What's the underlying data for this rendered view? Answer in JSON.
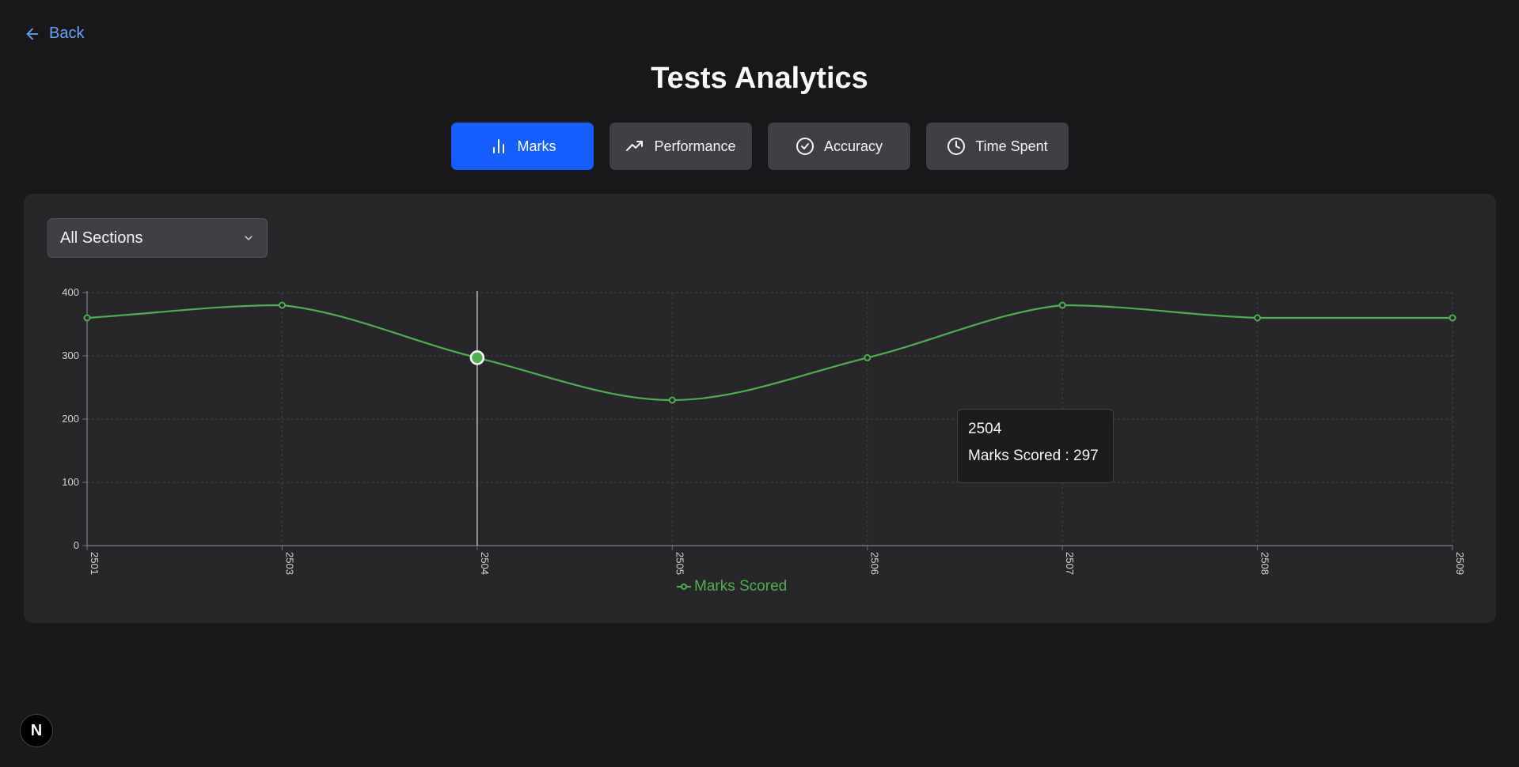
{
  "nav": {
    "back_label": "Back"
  },
  "page": {
    "title": "Tests Analytics"
  },
  "tabs": [
    {
      "label": "Marks",
      "icon": "bar-chart-icon",
      "active": true
    },
    {
      "label": "Performance",
      "icon": "trending-up-icon",
      "active": false
    },
    {
      "label": "Accuracy",
      "icon": "check-circle-icon",
      "active": false
    },
    {
      "label": "Time Spent",
      "icon": "clock-icon",
      "active": false
    }
  ],
  "filter": {
    "selected": "All Sections"
  },
  "tooltip": {
    "label": "2504",
    "series": "Marks Scored",
    "separator": " : ",
    "value": "297"
  },
  "colors": {
    "accent": "#155dfc",
    "line": "#4caf50",
    "background": "#18181b",
    "panel": "#27272a",
    "link": "#60a5fa"
  },
  "badge": {
    "letter": "N"
  },
  "chart_data": {
    "type": "line",
    "categories": [
      "2501",
      "2503",
      "2504",
      "2505",
      "2506",
      "2507",
      "2508",
      "2509"
    ],
    "series": [
      {
        "name": "Marks Scored",
        "values": [
          360,
          380,
          297,
          230,
          297,
          380,
          360,
          360
        ]
      }
    ],
    "ylim": [
      0,
      400
    ],
    "yticks": [
      0,
      100,
      200,
      300,
      400
    ],
    "grid": true,
    "legend": "bottom-center",
    "active_category": "2504"
  }
}
